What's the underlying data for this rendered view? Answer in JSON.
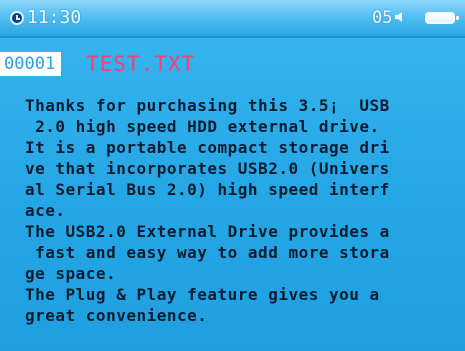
{
  "status_bar": {
    "time": "11:30",
    "volume_level": "05",
    "icons": [
      "clock-icon",
      "speaker-icon",
      "battery-icon"
    ],
    "colors": {
      "bar": "#53bff2",
      "text": "#e8f8ff"
    }
  },
  "file": {
    "index": "00001",
    "name": "TEST.TXT",
    "colors": {
      "name": "#ff3d72",
      "index_bg": "#ffffff"
    }
  },
  "document": {
    "lines": [
      "Thanks for purchasing this 3.5¡  USB",
      " 2.0 high speed HDD external drive.",
      "It is a portable compact storage dri",
      "ve that incorporates USB2.0 (Univers",
      "al Serial Bus 2.0) high speed interf",
      "ace.",
      "The USB2.0 External Drive provides a",
      " fast and easy way to add more stora",
      "ge space.",
      "The Plug & Play feature gives you a",
      "great convenience."
    ]
  }
}
